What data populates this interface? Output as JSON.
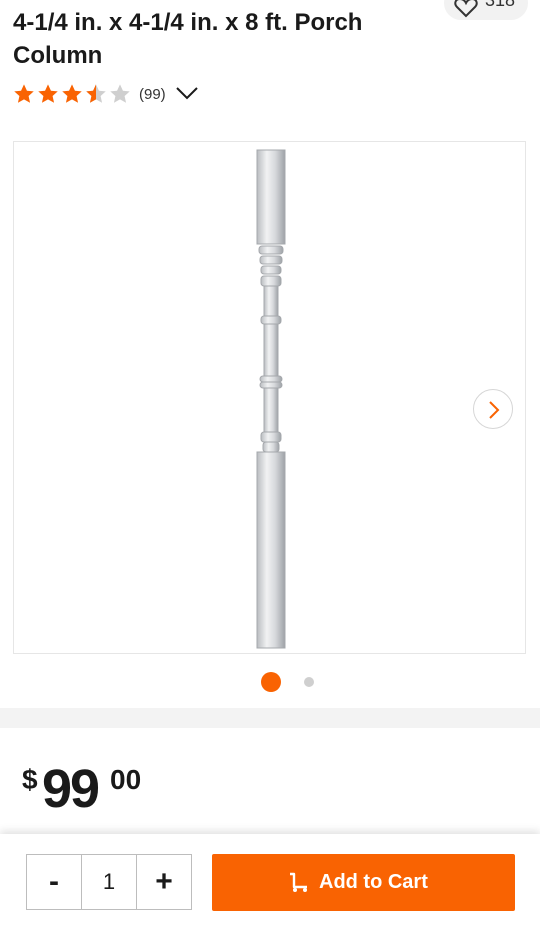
{
  "product": {
    "title": "4-1/4 in. x 4-1/4 in. x 8 ft. Porch Column",
    "favorites_count": "318",
    "rating": {
      "stars": 3.5,
      "max_stars": 5,
      "review_count_label": "(99)"
    }
  },
  "gallery": {
    "image_count": 2,
    "active_index": 0
  },
  "price": {
    "currency": "$",
    "dollars": "99",
    "cents": "00"
  },
  "purchase": {
    "decrement_label": "-",
    "quantity": "1",
    "increment_label": "+",
    "add_to_cart_label": "Add to Cart"
  },
  "colors": {
    "accent": "#f96302",
    "star": "#f96302",
    "star_empty": "#cfcfcf"
  },
  "icons": {
    "favorite": "heart-outline-icon",
    "expand": "chevron-down-icon",
    "next": "chevron-right-icon",
    "cart": "cart-icon"
  }
}
